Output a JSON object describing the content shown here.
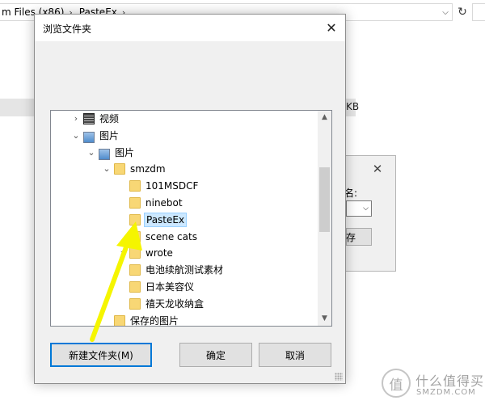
{
  "background": {
    "address_path": [
      "m Files (x86)",
      "PasteEx"
    ],
    "size_fragment": "KB",
    "small_dialog": {
      "label": "名:",
      "button_label": "保存"
    }
  },
  "dialog": {
    "title": "浏览文件夹",
    "tree": [
      {
        "label": "视频",
        "depth": 0,
        "expander": "collapsed",
        "icon": "video-icon"
      },
      {
        "label": "图片",
        "depth": 0,
        "expander": "expanded",
        "icon": "pictures-icon"
      },
      {
        "label": "图片",
        "depth": 1,
        "expander": "expanded",
        "icon": "pictures-icon"
      },
      {
        "label": "smzdm",
        "depth": 2,
        "expander": "expanded",
        "icon": "folder-icon"
      },
      {
        "label": "101MSDCF",
        "depth": 3,
        "expander": "none",
        "icon": "folder-icon"
      },
      {
        "label": "ninebot",
        "depth": 3,
        "expander": "none",
        "icon": "folder-icon"
      },
      {
        "label": "PasteEx",
        "depth": 3,
        "expander": "none",
        "icon": "folder-icon",
        "selected": true
      },
      {
        "label": "scene cats",
        "depth": 3,
        "expander": "none",
        "icon": "folder-icon"
      },
      {
        "label": "wrote",
        "depth": 3,
        "expander": "collapsed",
        "icon": "folder-icon"
      },
      {
        "label": "电池续航测试素材",
        "depth": 3,
        "expander": "none",
        "icon": "folder-icon"
      },
      {
        "label": "日本美容仪",
        "depth": 3,
        "expander": "none",
        "icon": "folder-icon"
      },
      {
        "label": "禧天龙收纳盒",
        "depth": 3,
        "expander": "none",
        "icon": "folder-icon"
      },
      {
        "label": "保存的图片",
        "depth": 2,
        "expander": "none",
        "icon": "folder-icon"
      }
    ],
    "buttons": {
      "new_folder": "新建文件夹(M)",
      "ok": "确定",
      "cancel": "取消"
    }
  },
  "watermark": {
    "text": "什么值得买",
    "sub": "SMZDM.COM",
    "glyph": "值"
  },
  "colors": {
    "selection_bg": "#cce8ff",
    "focus_border": "#0078d7",
    "arrow": "#f5f500"
  }
}
